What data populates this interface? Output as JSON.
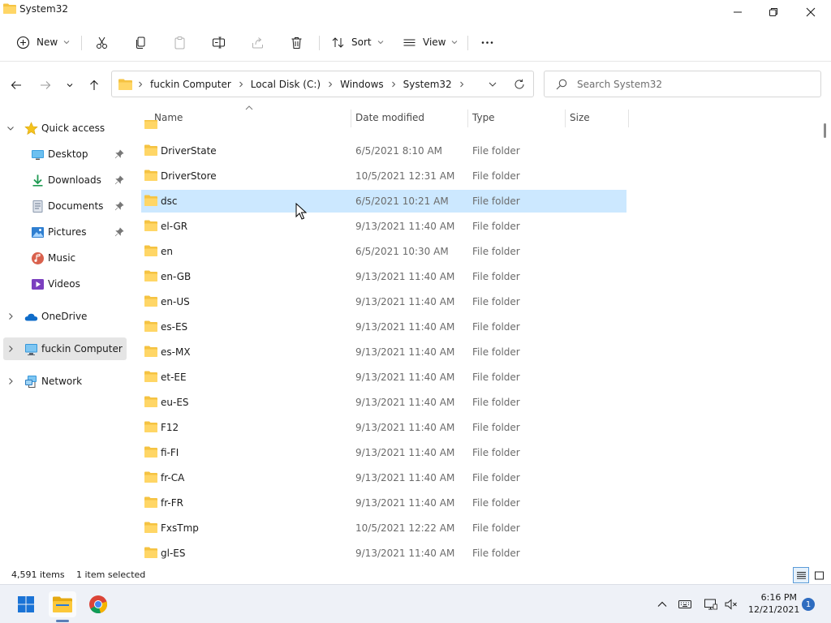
{
  "window": {
    "title": "System32",
    "buttons": [
      "minimize",
      "maximize",
      "close"
    ]
  },
  "commandbar": {
    "new_label": "New",
    "sort_label": "Sort",
    "view_label": "View"
  },
  "address": {
    "crumbs": [
      "fuckin Computer",
      "Local Disk (C:)",
      "Windows",
      "System32"
    ]
  },
  "search": {
    "placeholder": "Search System32"
  },
  "navpane": {
    "quick_access": "Quick access",
    "items": [
      {
        "label": "Desktop",
        "pinned": true
      },
      {
        "label": "Downloads",
        "pinned": true
      },
      {
        "label": "Documents",
        "pinned": true
      },
      {
        "label": "Pictures",
        "pinned": true
      },
      {
        "label": "Music",
        "pinned": false
      },
      {
        "label": "Videos",
        "pinned": false
      }
    ],
    "onedrive": "OneDrive",
    "computer": "fuckin Computer",
    "network": "Network"
  },
  "columns": {
    "name": "Name",
    "date": "Date modified",
    "type": "Type",
    "size": "Size"
  },
  "files": [
    {
      "name": "DriverState",
      "date": "6/5/2021 8:10 AM",
      "type": "File folder"
    },
    {
      "name": "DriverStore",
      "date": "10/5/2021 12:31 AM",
      "type": "File folder"
    },
    {
      "name": "dsc",
      "date": "6/5/2021 10:21 AM",
      "type": "File folder",
      "selected": true
    },
    {
      "name": "el-GR",
      "date": "9/13/2021 11:40 AM",
      "type": "File folder"
    },
    {
      "name": "en",
      "date": "6/5/2021 10:30 AM",
      "type": "File folder"
    },
    {
      "name": "en-GB",
      "date": "9/13/2021 11:40 AM",
      "type": "File folder"
    },
    {
      "name": "en-US",
      "date": "9/13/2021 11:40 AM",
      "type": "File folder"
    },
    {
      "name": "es-ES",
      "date": "9/13/2021 11:40 AM",
      "type": "File folder"
    },
    {
      "name": "es-MX",
      "date": "9/13/2021 11:40 AM",
      "type": "File folder"
    },
    {
      "name": "et-EE",
      "date": "9/13/2021 11:40 AM",
      "type": "File folder"
    },
    {
      "name": "eu-ES",
      "date": "9/13/2021 11:40 AM",
      "type": "File folder"
    },
    {
      "name": "F12",
      "date": "9/13/2021 11:40 AM",
      "type": "File folder"
    },
    {
      "name": "fi-FI",
      "date": "9/13/2021 11:40 AM",
      "type": "File folder"
    },
    {
      "name": "fr-CA",
      "date": "9/13/2021 11:40 AM",
      "type": "File folder"
    },
    {
      "name": "fr-FR",
      "date": "9/13/2021 11:40 AM",
      "type": "File folder"
    },
    {
      "name": "FxsTmp",
      "date": "10/5/2021 12:22 AM",
      "type": "File folder"
    },
    {
      "name": "gl-ES",
      "date": "9/13/2021 11:40 AM",
      "type": "File folder"
    }
  ],
  "status": {
    "item_count": "4,591 items",
    "selection": "1 item selected"
  },
  "taskbar": {
    "time": "6:16 PM",
    "date": "12/21/2021",
    "notifications": "1"
  },
  "colors": {
    "selection": "#cce8ff",
    "folder": "#f5c342",
    "accent": "#0067c0"
  }
}
